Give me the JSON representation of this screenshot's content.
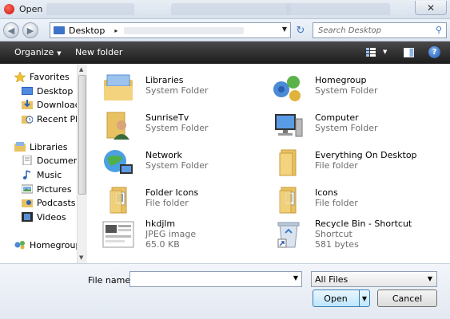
{
  "window": {
    "title": "Open",
    "close_glyph": "✕"
  },
  "address_bar": {
    "location": "Desktop",
    "separator": "▸",
    "dropdown": "▼",
    "refresh_glyph": "↻"
  },
  "nav_buttons": {
    "back": "◀",
    "forward": "▶"
  },
  "search": {
    "placeholder": "Search Desktop",
    "icon": "search-icon",
    "glyph": "⚲"
  },
  "toolbar": {
    "organize_label": "Organize",
    "organize_caret": "▼",
    "new_folder_label": "New folder",
    "view_caret": "▼",
    "help_glyph": "?"
  },
  "navigation": {
    "favorites_header": "Favorites",
    "favorites": [
      {
        "label": "Desktop",
        "icon": "desktop-icon"
      },
      {
        "label": "Downloads",
        "icon": "downloads-icon"
      },
      {
        "label": "Recent Places",
        "icon": "recent-places-icon"
      }
    ],
    "libraries_header": "Libraries",
    "libraries": [
      {
        "label": "Documents",
        "icon": "documents-icon"
      },
      {
        "label": "Music",
        "icon": "music-icon"
      },
      {
        "label": "Pictures",
        "icon": "pictures-icon"
      },
      {
        "label": "Podcasts",
        "icon": "podcasts-icon"
      },
      {
        "label": "Videos",
        "icon": "videos-icon"
      }
    ],
    "homegroup": "Homegroup",
    "scroll_up": "▲",
    "scroll_down": "▼"
  },
  "items": [
    {
      "name": "Libraries",
      "line2": "System Folder",
      "line3": "",
      "icon": "libraries-icon"
    },
    {
      "name": "Homegroup",
      "line2": "System Folder",
      "line3": "",
      "icon": "homegroup-icon"
    },
    {
      "name": "SunriseTv",
      "line2": "System Folder",
      "line3": "",
      "icon": "user-folder-icon"
    },
    {
      "name": "Computer",
      "line2": "System Folder",
      "line3": "",
      "icon": "computer-icon"
    },
    {
      "name": "Network",
      "line2": "System Folder",
      "line3": "",
      "icon": "network-icon"
    },
    {
      "name": "Everything On Desktop",
      "line2": "File folder",
      "line3": "",
      "icon": "folder-icon"
    },
    {
      "name": "Folder Icons",
      "line2": "File folder",
      "line3": "",
      "icon": "folder-icon"
    },
    {
      "name": "Icons",
      "line2": "File folder",
      "line3": "",
      "icon": "folder-icon"
    },
    {
      "name": "hkdjlm",
      "line2": "JPEG image",
      "line3": "65.0 KB",
      "icon": "image-thumbnail-icon"
    },
    {
      "name": "Recycle Bin - Shortcut",
      "line2": "Shortcut",
      "line3": "581 bytes",
      "icon": "recycle-bin-icon"
    }
  ],
  "bottom": {
    "file_name_label": "File name:",
    "file_name_value": "",
    "dropdown_glyph": "▼",
    "filter_value": "All Files",
    "open_label": "Open",
    "cancel_label": "Cancel"
  },
  "colors": {
    "command_bar": "#1c1c1c",
    "folder": "#e8c262",
    "accent": "#3d73c8"
  }
}
